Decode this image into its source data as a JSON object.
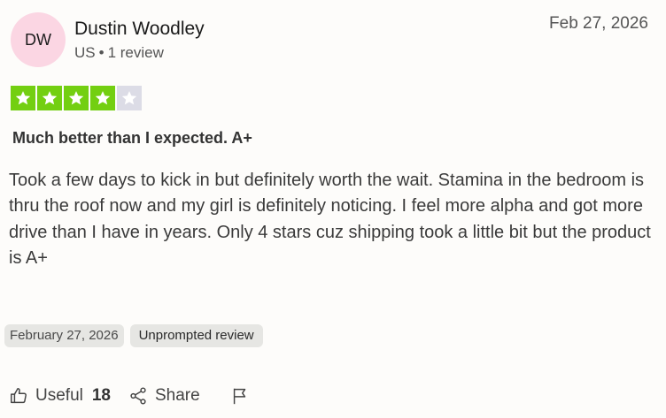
{
  "reviewer": {
    "initials": "DW",
    "name": "Dustin Woodley",
    "country": "US",
    "review_count": "1 review"
  },
  "review": {
    "date_short": "Feb 27, 2026",
    "rating": 4,
    "max_rating": 5,
    "title": "Much better than I expected. A+",
    "body": "Took a few days to kick in but definitely worth the wait. Stamina in the bedroom is thru the roof now and my girl is definitely noticing. I feel more alpha and got more drive than I have in years. Only 4 stars cuz shipping took a little bit but the product is A+",
    "date_long": "February 27, 2026",
    "badge": "Unprompted review"
  },
  "actions": {
    "useful_label": "Useful",
    "useful_count": "18",
    "share_label": "Share"
  },
  "colors": {
    "star_filled": "#73cf11",
    "star_empty": "#dcdce6",
    "avatar_bg": "#fbd6e3"
  },
  "icons": {
    "star": "star-icon",
    "useful": "thumbs-up-icon",
    "share": "share-icon",
    "flag": "flag-icon"
  }
}
